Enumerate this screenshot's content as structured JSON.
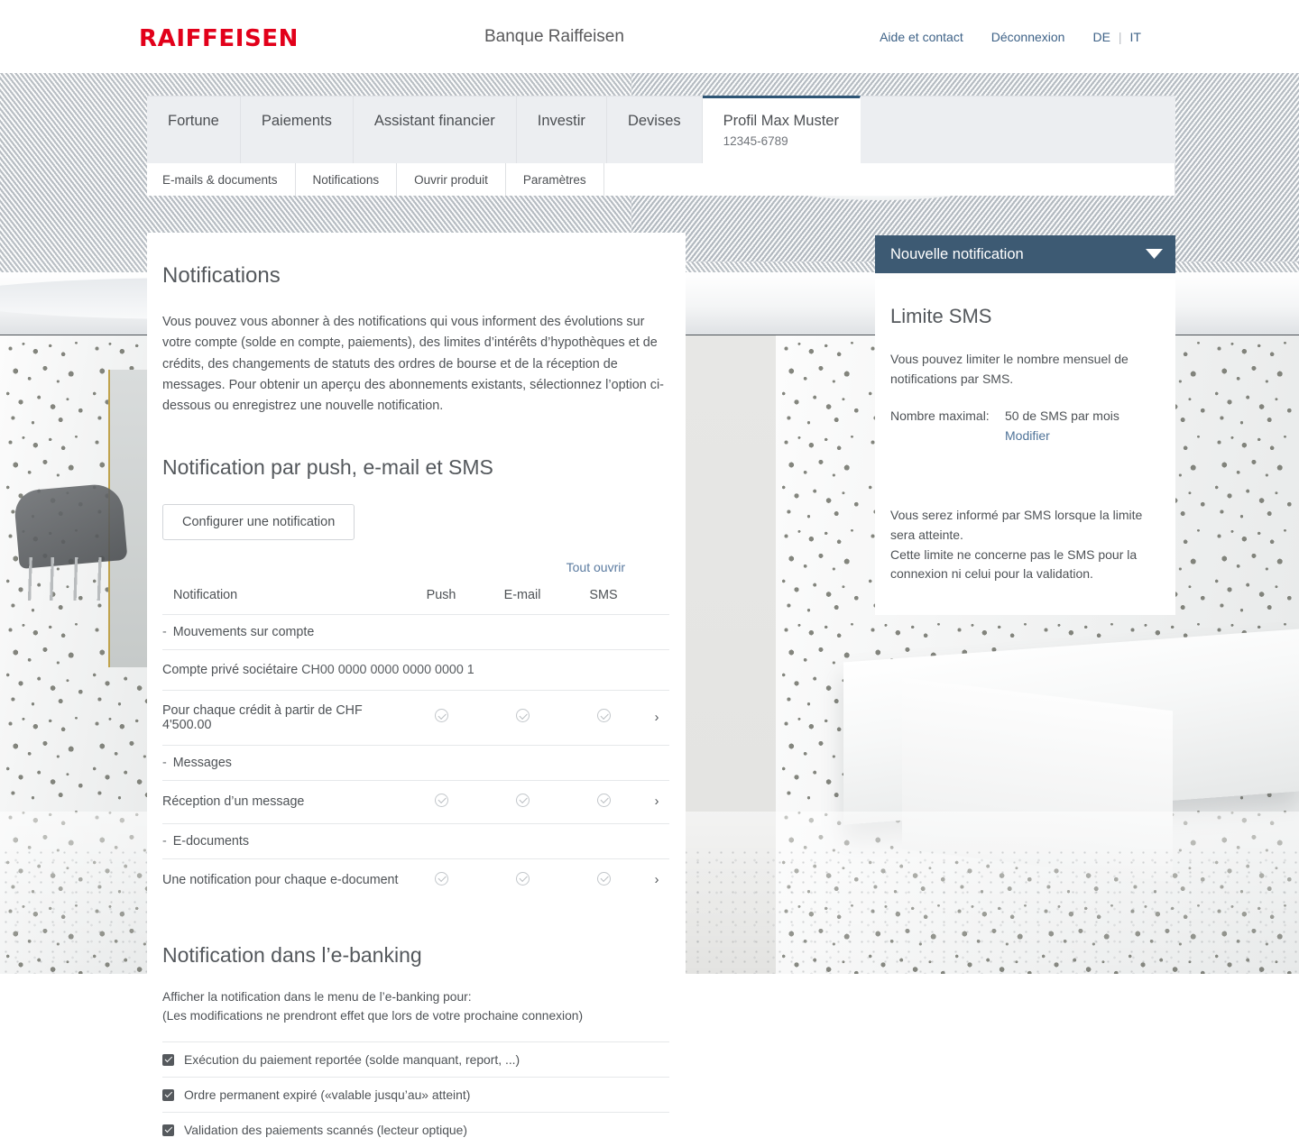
{
  "header": {
    "logo": "RAIFFEISEN",
    "bank_name": "Banque Raiffeisen",
    "links": [
      {
        "label": "Aide et contact",
        "name": "help-contact-link"
      },
      {
        "label": "Déconnexion",
        "name": "logout-link"
      }
    ],
    "languages": {
      "de": "DE",
      "it": "IT",
      "separator": "|"
    }
  },
  "main_tabs": [
    {
      "label": "Fortune",
      "sub": "",
      "active": false
    },
    {
      "label": "Paiements",
      "sub": "",
      "active": false
    },
    {
      "label": "Assistant financier",
      "sub": "",
      "active": false
    },
    {
      "label": "Investir",
      "sub": "",
      "active": false
    },
    {
      "label": "Devises",
      "sub": "",
      "active": false
    },
    {
      "label": "Profil Max Muster",
      "sub": "12345-6789",
      "active": true
    }
  ],
  "sub_tabs": [
    {
      "label": "E-mails & documents"
    },
    {
      "label": "Notifications"
    },
    {
      "label": "Ouvrir produit"
    },
    {
      "label": "Paramètres"
    }
  ],
  "main": {
    "page_title": "Notifications",
    "intro": "Vous pouvez vous abonner à des notifications qui vous informent des évolutions sur votre compte (solde en compte, paiements), des limites d’intérêts d’hypothèques et de crédits, des changements de statuts des ordres de bourse et de la réception de messages. Pour obtenir un aperçu des abonnements existants, sélectionnez l’option ci-dessous ou enregistrez une nouvelle notification.",
    "section2_title": "Notification par push, e-mail et SMS",
    "configure_button": "Configurer une notification",
    "expand_all_link": "Tout ouvrir",
    "table": {
      "headers": {
        "notification": "Notification",
        "push": "Push",
        "email": "E-mail",
        "sms": "SMS"
      },
      "groups": [
        {
          "name": "Mouvements sur compte",
          "collapse_marker": "-",
          "account": {
            "label": "Compte privé sociétaire",
            "iban": "CH00 0000 0000 0000 0000 1"
          },
          "rows": [
            {
              "label": "Pour chaque crédit à partir de CHF 4'500.00",
              "push": "check-circle-icon",
              "email": "check-circle-icon",
              "sms": "check-circle-icon",
              "arrow": "chevron-right-icon"
            }
          ]
        },
        {
          "name": "Messages",
          "collapse_marker": "-",
          "rows": [
            {
              "label": "Réception d’un message",
              "push": "check-circle-icon",
              "email": "check-circle-icon",
              "sms": "check-circle-icon",
              "arrow": "chevron-right-icon"
            }
          ]
        },
        {
          "name": "E-documents",
          "collapse_marker": "-",
          "rows": [
            {
              "label": "Une notification pour chaque e-document",
              "push": "check-circle-icon",
              "email": "check-circle-icon",
              "sms": "check-circle-icon",
              "arrow": "chevron-right-icon"
            }
          ]
        }
      ]
    },
    "section3_title": "Notification dans l’e-banking",
    "ebanking_desc_line1": "Afficher la notification dans le menu de l’e-banking pour:",
    "ebanking_desc_line2": "(Les modifications ne prendront effet que lors de votre prochaine connexion)",
    "checkboxes": [
      {
        "label": "Exécution du paiement reportée (solde manquant, report, ...)",
        "checked": true
      },
      {
        "label": "Ordre permanent expiré («valable jusqu’au» atteint)",
        "checked": true
      },
      {
        "label": "Validation des paiements scannés (lecteur optique)",
        "checked": true
      }
    ]
  },
  "right_panel": {
    "bar_title": "Nouvelle notification",
    "bar_icon": "chevron-down-icon",
    "card": {
      "title": "Limite SMS",
      "description": "Vous pouvez limiter le nombre mensuel de notifications par SMS.",
      "max_label": "Nombre maximal:",
      "max_value": "50 de SMS par mois",
      "modify_link": "Modifier",
      "footer": "Vous serez informé par SMS lorsque la limite sera atteinte.\nCette limite ne concerne pas le SMS pour la connexion ni celui pour la validation."
    }
  },
  "colors": {
    "brand_red": "#e2001a",
    "panel_blue": "#3d5a73",
    "active_tab_border": "#2e5575",
    "link_blue": "#3e6287"
  }
}
